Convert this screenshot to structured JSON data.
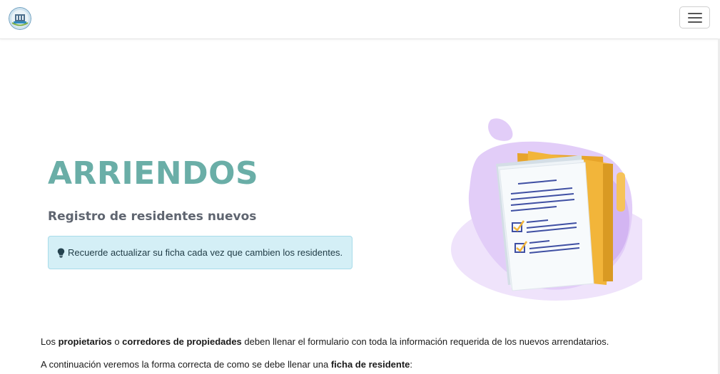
{
  "navbar": {
    "logo_icon": "building-logo-icon",
    "menu_icon": "hamburger-menu-icon"
  },
  "hero": {
    "title": "ARRIENDOS",
    "subtitle": "Registro de residentes nuevos",
    "alert": {
      "icon": "lightbulb-icon",
      "text": "Recuerde actualizar su ficha cada vez que cambien los residentes."
    },
    "illustration": "folder-documents-checklist-illustration"
  },
  "content": {
    "p1": {
      "t1": "Los ",
      "b1": "propietarios",
      "t2": " o ",
      "b2": "corredores de propiedades",
      "t3": " deben llenar el formulario con toda la información requerida de los nuevos arrendatarios."
    },
    "p2": {
      "t1": "A continuación veremos la forma correcta de como se debe llenar una ",
      "b1": "ficha de residente",
      "t2": ":"
    }
  },
  "colors": {
    "title": "#6aaea7",
    "subtitle": "#5f6570",
    "alert_bg": "#d4eff6",
    "alert_border": "#a8dcea",
    "folder": "#f2b53a",
    "blob": "#d9c2f4"
  }
}
